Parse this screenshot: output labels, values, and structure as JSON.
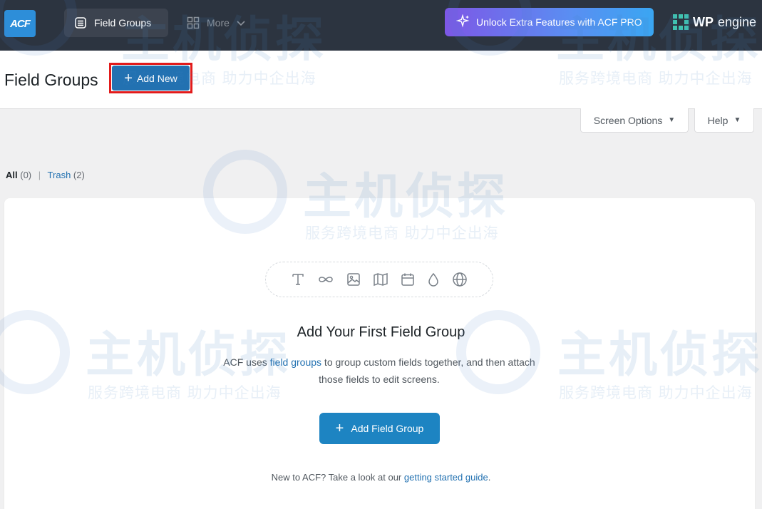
{
  "topbar": {
    "logo_text": "ACF",
    "nav_field_groups": "Field Groups",
    "nav_more": "More",
    "pro_label": "Unlock Extra Features with ACF PRO",
    "wpengine_wp": "WP",
    "wpengine_engine": "engine"
  },
  "header": {
    "title": "Field Groups",
    "add_new_label": "Add New"
  },
  "screen_meta": {
    "screen_options_label": "Screen Options",
    "help_label": "Help"
  },
  "filters": {
    "all_label": "All",
    "all_count": "(0)",
    "separator": "|",
    "trash_label": "Trash",
    "trash_count": "(2)"
  },
  "empty_state": {
    "field_type_icons": [
      "text-icon",
      "infinity-icon",
      "image-icon",
      "map-icon",
      "calendar-icon",
      "color-drop-icon",
      "globe-icon"
    ],
    "title": "Add Your First Field Group",
    "desc_before": "ACF uses ",
    "desc_link": "field groups",
    "desc_after": " to group custom fields together, and then attach those fields to edit screens.",
    "button_label": "Add Field Group",
    "footer_before": "New to ACF? Take a look at our ",
    "footer_link": "getting started guide",
    "footer_after": "."
  },
  "watermark": {
    "brand": "主机侦探",
    "slogan": "服务跨境电商 助力中企出海"
  },
  "colors": {
    "topbar_bg": "#2c3440",
    "wp_blue": "#2271b1",
    "acf_button": "#1d84c2",
    "highlight_red": "#e21b1b"
  }
}
